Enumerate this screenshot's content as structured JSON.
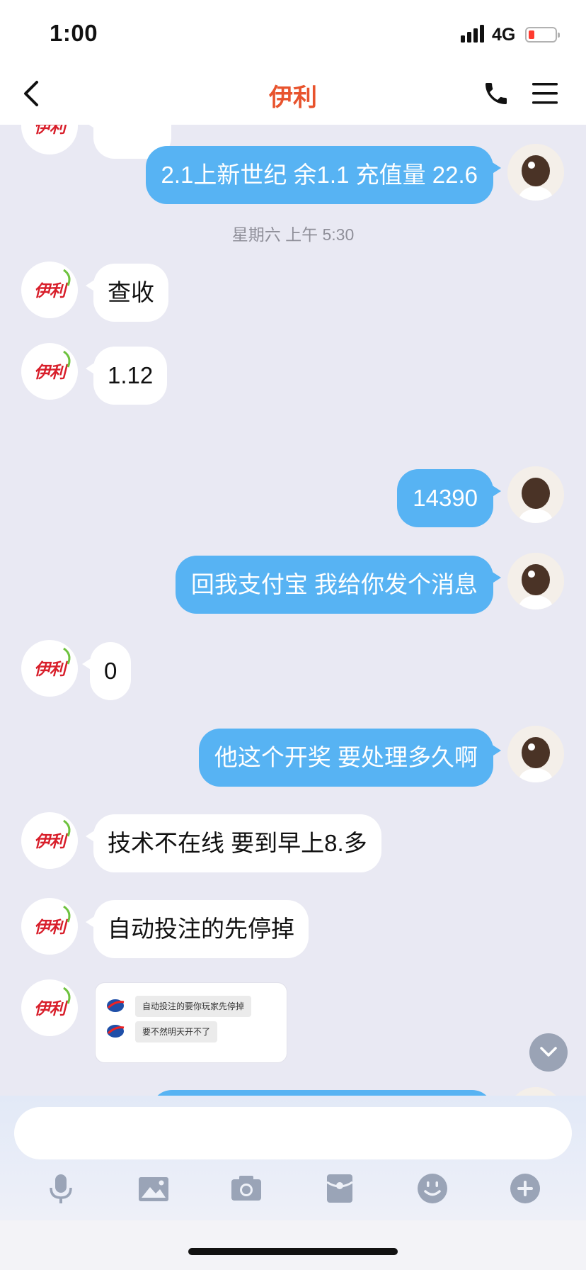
{
  "status_bar": {
    "time": "1:00",
    "network": "4G",
    "battery_color": "#ff3b30"
  },
  "header": {
    "title": "伊利",
    "title_color": "#e8532d",
    "icons": [
      "back-icon",
      "phone-icon",
      "menu-icon"
    ]
  },
  "chat": {
    "peer_avatar_text": "伊利",
    "bubble_sent_color": "#57b3f3",
    "bubble_received_color": "#ffffff",
    "messages": [
      {
        "side": "right",
        "text": "2.1上新世纪 余1.1 充值量 22.6"
      },
      {
        "type": "timestamp",
        "text": "星期六 上午 5:30"
      },
      {
        "side": "left",
        "text": "查收"
      },
      {
        "side": "left",
        "text": "1.12"
      },
      {
        "side": "right",
        "text": "14390"
      },
      {
        "side": "right",
        "text": "回我支付宝 我给你发个消息"
      },
      {
        "side": "left",
        "text": "0"
      },
      {
        "side": "right",
        "text": "他这个开奖 要处理多久啊"
      },
      {
        "side": "left",
        "text": "技术不在线  要到早上8.多"
      },
      {
        "side": "left",
        "text": "自动投注的先停掉"
      },
      {
        "side": "left",
        "type": "image",
        "lines": [
          "自动投注的要你玩家先停掉",
          "要不然明天开不了"
        ]
      }
    ]
  },
  "input": {
    "placeholder": "",
    "toolbar": [
      "microphone-icon",
      "image-icon",
      "camera-icon",
      "red-packet-icon",
      "emoji-icon",
      "plus-icon"
    ]
  }
}
